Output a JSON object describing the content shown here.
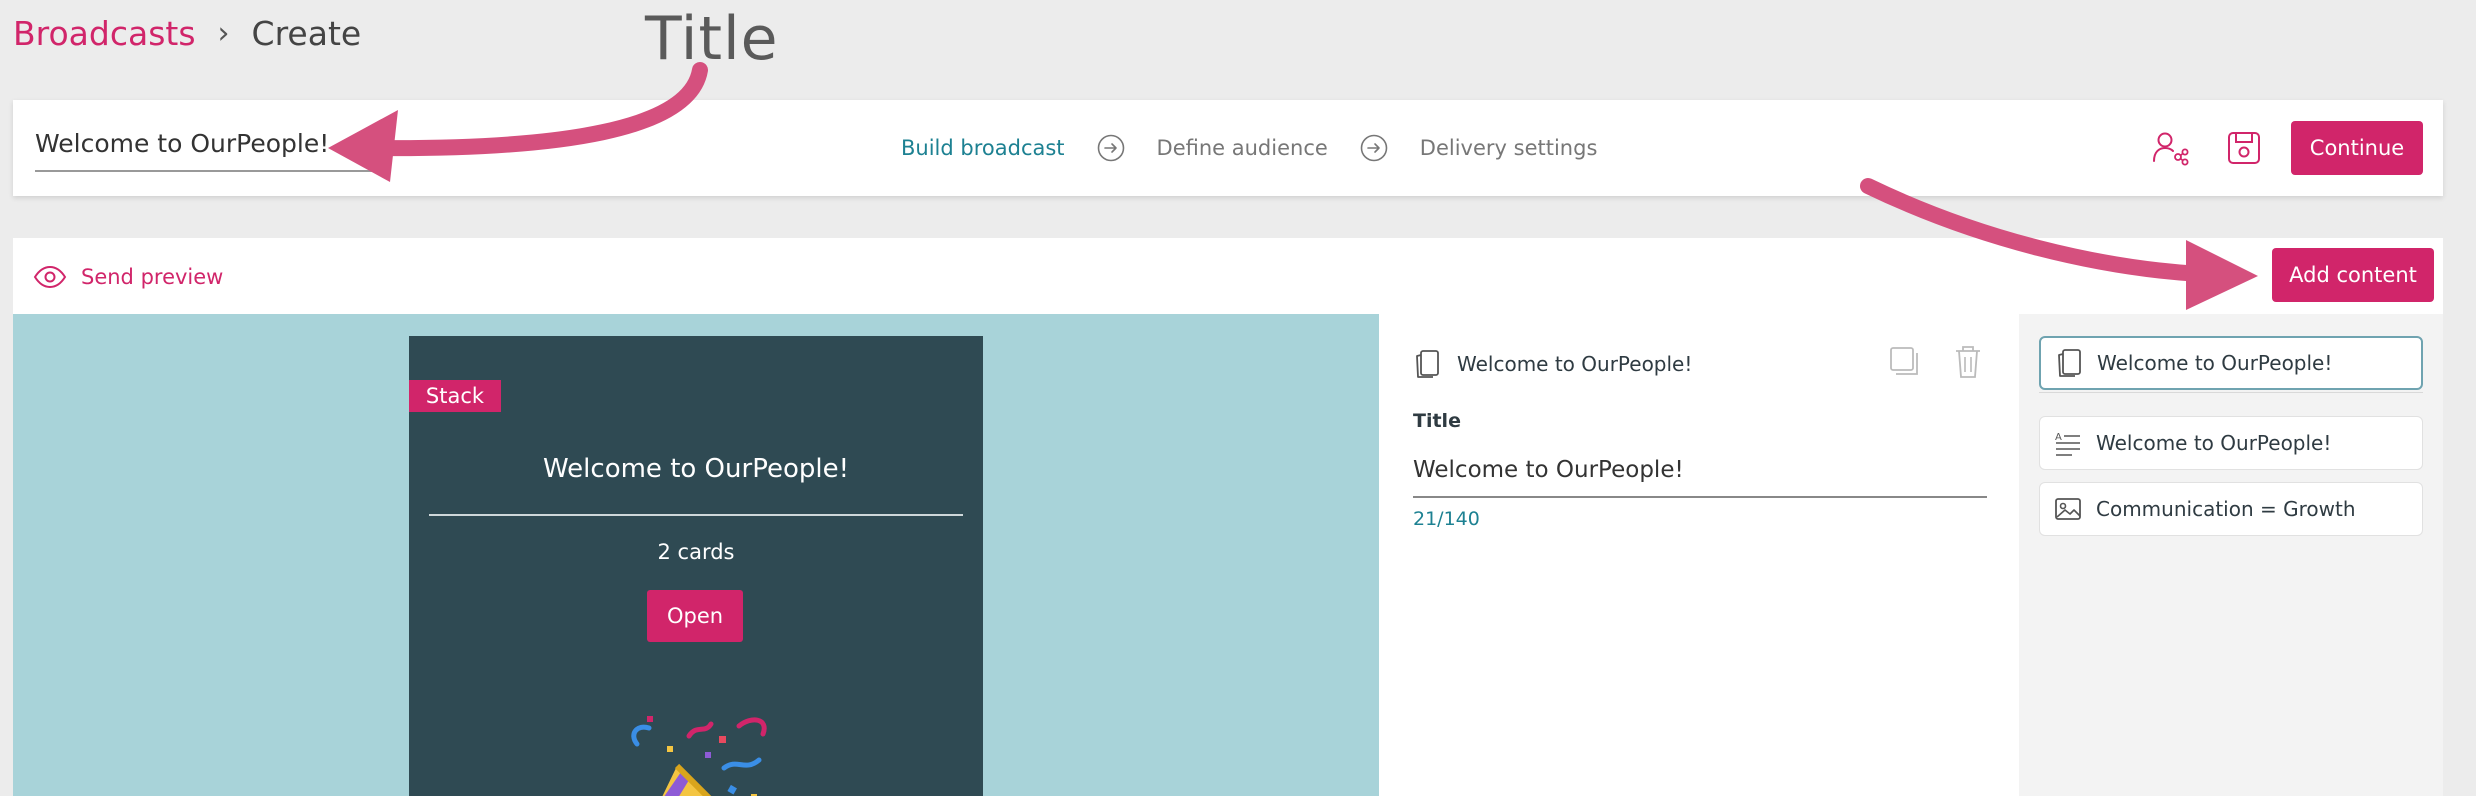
{
  "breadcrumb": {
    "root": "Broadcasts",
    "separator": "›",
    "current": "Create"
  },
  "annotation": {
    "title_label": "Title"
  },
  "topbar": {
    "title_value": "Welcome to OurPeople!",
    "steps": [
      {
        "label": "Build broadcast",
        "active": true
      },
      {
        "label": "Define audience",
        "active": false
      },
      {
        "label": "Delivery settings",
        "active": false
      }
    ],
    "continue_label": "Continue"
  },
  "panel": {
    "send_preview_label": "Send preview",
    "add_content_label": "Add content"
  },
  "preview": {
    "tag": "Stack",
    "title": "Welcome to OurPeople!",
    "count": "2 cards",
    "open_label": "Open"
  },
  "editor": {
    "header_title": "Welcome to OurPeople!",
    "field_label": "Title",
    "field_value": "Welcome to OurPeople!",
    "char_count": "21/140"
  },
  "outline": {
    "items": [
      {
        "label": "Welcome to OurPeople!",
        "icon": "stack-icon"
      },
      {
        "label": "Welcome to OurPeople!",
        "icon": "text-card-icon"
      },
      {
        "label": "Communication = Growth",
        "icon": "image-card-icon"
      }
    ]
  },
  "colors": {
    "brand": "#d1256a",
    "teal": "#1d8192",
    "preview_bg": "#a8d3d9",
    "card_bg": "#2f4a53"
  }
}
